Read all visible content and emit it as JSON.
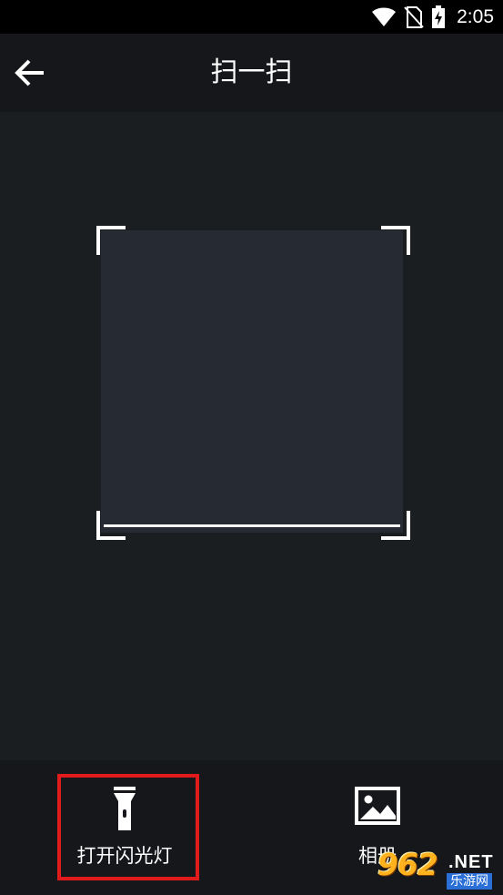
{
  "status_bar": {
    "time": "2:05",
    "icons": [
      "wifi-icon",
      "no-sim-icon",
      "battery-charging-icon"
    ]
  },
  "app_bar": {
    "back_icon": "arrow-left-icon",
    "title": "扫一扫"
  },
  "scanner": {
    "frame_icon": "scan-frame"
  },
  "bottom_bar": {
    "flashlight": {
      "label": "打开闪光灯",
      "icon": "flashlight-icon"
    },
    "album": {
      "label": "相册",
      "icon": "image-icon"
    }
  },
  "watermark": {
    "logo": "962",
    "suffix": ".NET",
    "caption": "乐游网"
  },
  "colors": {
    "background": "#1b1d20",
    "app_bar": "#15171a",
    "scan_box": "#252a33",
    "highlight": "#e11b1b",
    "text": "#ffffff"
  }
}
